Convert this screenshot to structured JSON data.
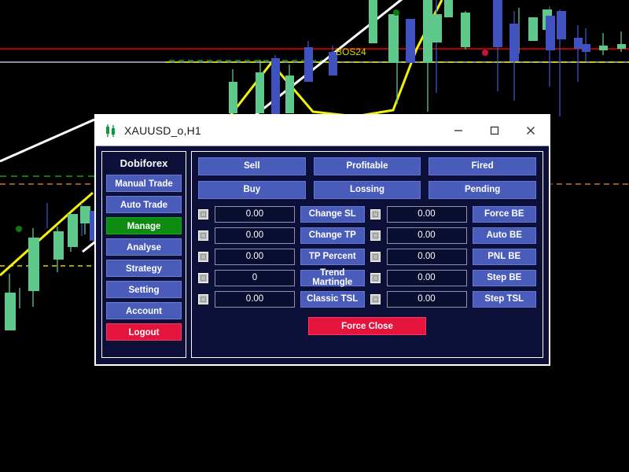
{
  "window": {
    "title": "XAUUSD_o,H1",
    "icon": "candlestick-icon",
    "minimize_label": "—",
    "maximize_label": "□",
    "close_label": "✕"
  },
  "sidebar": {
    "brand": "Dobiforex",
    "items": [
      {
        "label": "Manual Trade",
        "state": "normal"
      },
      {
        "label": "Auto Trade",
        "state": "normal"
      },
      {
        "label": "Manage",
        "state": "active"
      },
      {
        "label": "Analyse",
        "state": "normal"
      },
      {
        "label": "Strategy",
        "state": "normal"
      },
      {
        "label": "Setting",
        "state": "normal"
      },
      {
        "label": "Account",
        "state": "normal"
      },
      {
        "label": "Logout",
        "state": "danger"
      }
    ]
  },
  "main": {
    "top_buttons": [
      "Sell",
      "Profitable",
      "Fired",
      "Buy",
      "Lossing",
      "Pending"
    ],
    "rows": [
      {
        "left_checkbox": false,
        "left_value": "0.00",
        "left_button": "Change SL",
        "right_checkbox": false,
        "right_value": "0.00",
        "right_button": "Force BE"
      },
      {
        "left_checkbox": false,
        "left_value": "0.00",
        "left_button": "Change TP",
        "right_checkbox": false,
        "right_value": "0.00",
        "right_button": "Auto BE"
      },
      {
        "left_checkbox": false,
        "left_value": "0.00",
        "left_button": "TP Percent",
        "right_checkbox": false,
        "right_value": "0.00",
        "right_button": "PNL BE"
      },
      {
        "left_checkbox": false,
        "left_value": "0",
        "left_button": "Trend Martingle",
        "right_checkbox": false,
        "right_value": "0.00",
        "right_button": "Step BE"
      },
      {
        "left_checkbox": false,
        "left_value": "0.00",
        "left_button": "Classic TSL",
        "right_checkbox": false,
        "right_value": "0.00",
        "right_button": "Step TSL"
      }
    ],
    "force_close_label": "Force Close"
  },
  "chart": {
    "background": "#000000",
    "annotation_label": "BOS24",
    "annotation_color": "#d8d800",
    "resistance_line_color": "#b00000",
    "structure_line_color": "#b8c0d8",
    "trendline_color": "#ffffff",
    "zigzag_color": "#f2f209",
    "bull_candle_color": "#5ec98a",
    "bear_candle_color": "#3f52c0",
    "dot_buy_color": "#0f7a10",
    "dot_sell_color": "#cc1040",
    "green_dashed_color": "#18a018",
    "orange_dashed_color": "#c07a2a"
  },
  "colors": {
    "dialog_bg": "#0c1038",
    "button_blue": "#4a5cba",
    "accent_green": "#0c8b10",
    "accent_red": "#e4143c",
    "titlebar_bg": "#ffffff"
  }
}
